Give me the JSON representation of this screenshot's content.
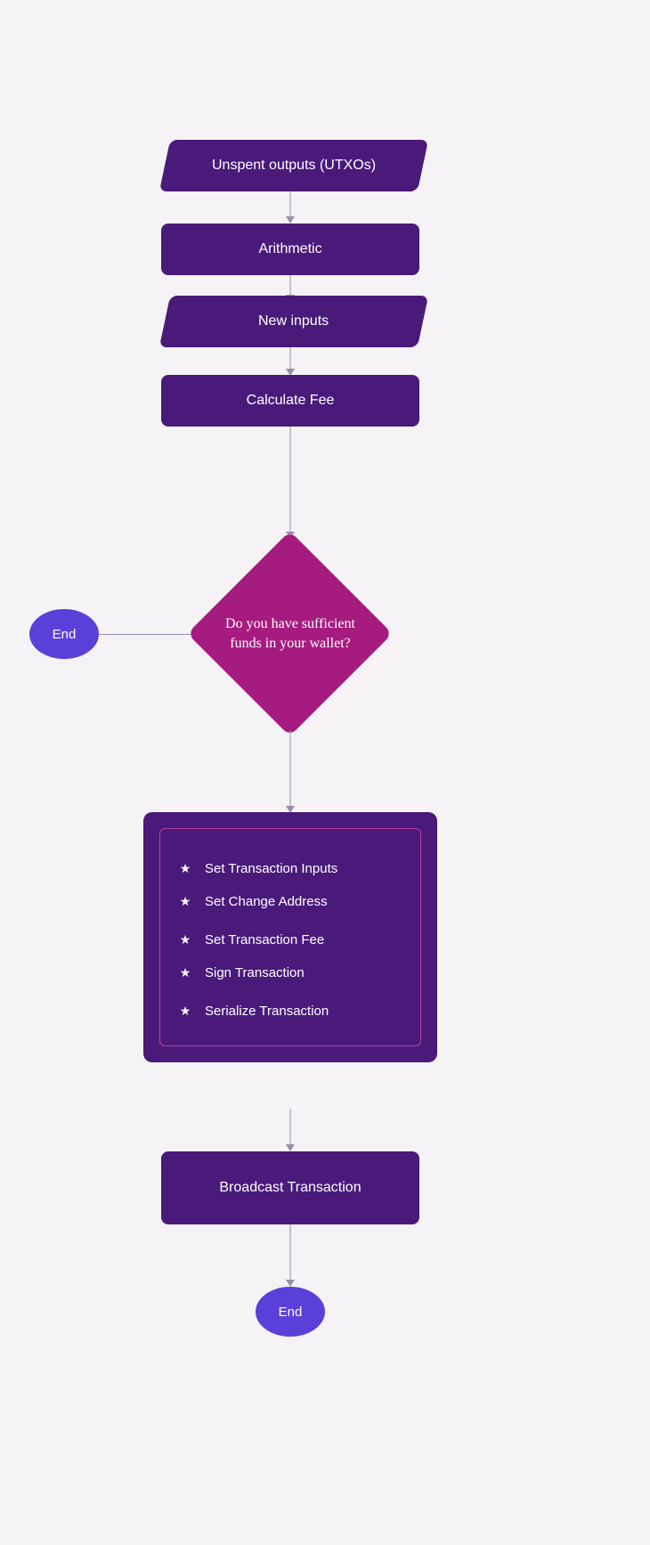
{
  "nodes": {
    "utxos": "Unspent outputs (UTXOs)",
    "arithmetic": "Arithmetic",
    "newinputs": "New inputs",
    "calcfee": "Calculate Fee",
    "decision": "Do you have sufficient funds in your wallet?",
    "end_left": "End",
    "end_bottom": "End",
    "broadcast": "Broadcast Transaction"
  },
  "steps": [
    "Set Transaction Inputs",
    "Set Change Address",
    "Set Transaction Fee",
    "Sign Transaction",
    "Serialize Transaction"
  ],
  "colors": {
    "node_purple": "#4a1a7a",
    "decision_magenta": "#a61b7f",
    "end_indigo": "#5b3fd9",
    "bg": "#f5f3f6"
  }
}
